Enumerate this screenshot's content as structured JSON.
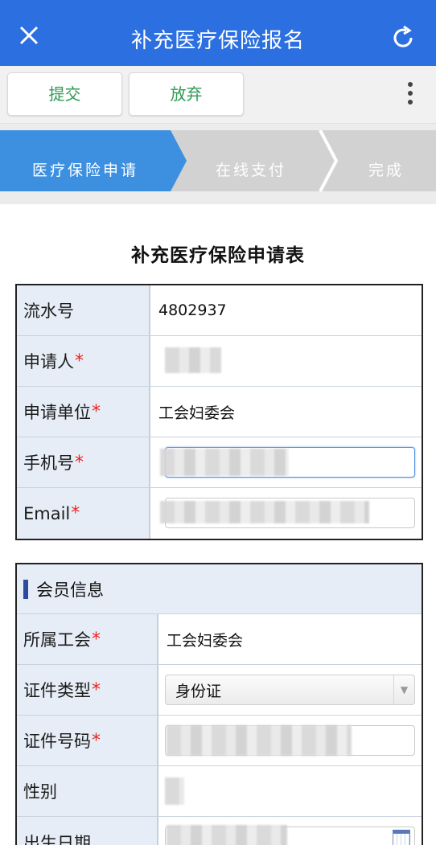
{
  "nav": {
    "title": "补充医疗保险报名"
  },
  "toolbar": {
    "submit_label": "提交",
    "abandon_label": "放弃"
  },
  "steps": [
    {
      "label": "医疗保险申请",
      "active": true
    },
    {
      "label": "在线支付",
      "active": false
    },
    {
      "label": "完成",
      "active": false
    }
  ],
  "form": {
    "title": "补充医疗保险申请表",
    "serial_label": "流水号",
    "serial_value": "4802937",
    "applicant_label": "申请人",
    "unit_label": "申请单位",
    "unit_value": "工会妇委会",
    "phone_label": "手机号",
    "email_label": "Email",
    "required_mark": "*"
  },
  "member": {
    "section_title": "会员信息",
    "union_label": "所属工会",
    "union_value": "工会妇委会",
    "id_type_label": "证件类型",
    "id_type_value": "身份证",
    "id_number_label": "证件号码",
    "gender_label": "性别",
    "birth_label": "出生日期"
  },
  "colors": {
    "nav_bg": "#2b6fe0",
    "active_step": "#3d8fe0",
    "inactive_step": "#d2d2d2",
    "button_text": "#2f9a55",
    "required": "#e22222"
  }
}
